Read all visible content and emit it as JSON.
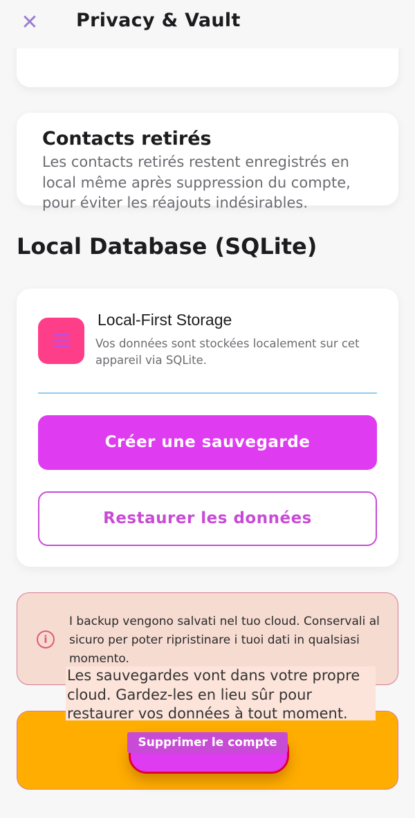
{
  "header": {
    "close_icon": "close-icon",
    "title": "Privacy & Vault"
  },
  "contacts_card": {
    "title": "Contacts retirés",
    "description": "Les contacts retirés restent enregistrés en local même après suppression du compte, pour éviter les réajouts indésirables."
  },
  "database_section": {
    "title": "Local Database (SQLite)",
    "storage": {
      "icon": "list-icon",
      "title": "Local-First Storage",
      "description": "Vos données sont stockées localement sur cet appareil via SQLite."
    },
    "create_backup_label": "Créer une sauvegarde",
    "restore_label": "Restaurer les données"
  },
  "backup_info": {
    "icon": "info-icon",
    "text": "I backup vengono salvati nel tuo cloud. Conservali al sicuro per poter ripristinare i tuoi dati in qualsiasi momento.",
    "overlay_text": "Les sauvegardes vont dans votre propre cloud. Gardez-les en lieu sûr pour restaurer vos données à tout moment."
  },
  "danger_zone": {
    "delete_account_label": "Supprimer le compte"
  },
  "colors": {
    "accent": "#df3bf0",
    "accent_outline": "#c84bd6",
    "icon_bg": "#ff3e8a",
    "info_bg": "#f6dbd1",
    "danger_bg": "#ffad00",
    "danger_border": "#e2002c"
  }
}
